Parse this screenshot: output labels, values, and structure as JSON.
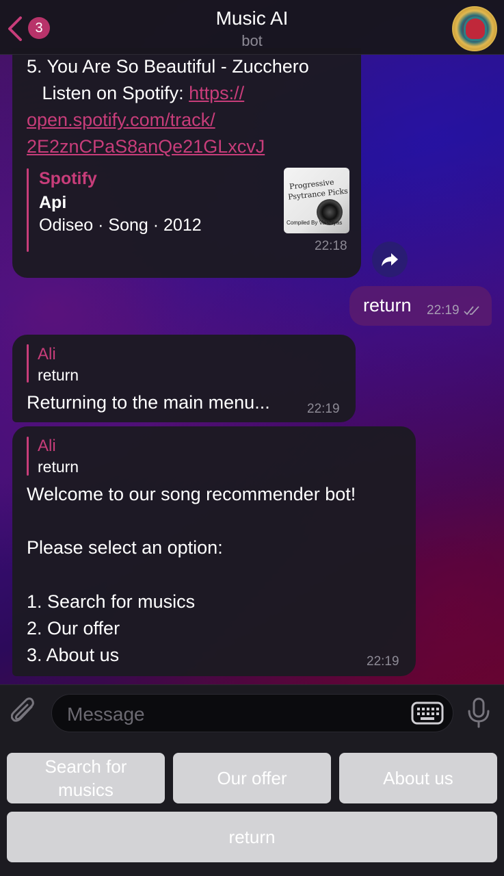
{
  "header": {
    "back_badge": "3",
    "title": "Music AI",
    "subtitle": "bot"
  },
  "messages": {
    "m1": {
      "line1": "5. You Are So Beautiful - Zucchero",
      "line2": "   Listen on Spotify: ",
      "link1": "https://",
      "link2": "open.spotify.com/track/",
      "link3": "2E2znCPaS8anQe21GLxcvJ",
      "preview": {
        "site": "Spotify",
        "title": "Api",
        "desc": "Odiseo · Song · 2012",
        "thumb_line1": "Progressive",
        "thumb_line2": "Psytrance Picks",
        "thumb_line3": "Compiled By Vaishiyas"
      },
      "time": "22:18"
    },
    "m2": {
      "text": "return",
      "time": "22:19"
    },
    "m3": {
      "quote_name": "Ali",
      "quote_text": "return",
      "text": "Returning to the main menu...",
      "time": "22:19"
    },
    "m4": {
      "quote_name": "Ali",
      "quote_text": "return",
      "lines": [
        "Welcome to our song recommender bot!",
        "",
        "Please select an option:",
        "",
        "1. Search for musics",
        "2. Our offer",
        "3. About us"
      ],
      "time": "22:19"
    }
  },
  "input": {
    "placeholder": "Message"
  },
  "keyboard": {
    "b1_line1": "Search for",
    "b1_line2": "musics",
    "b2": "Our offer",
    "b3": "About us",
    "b4": "return"
  },
  "icons": {
    "back": "chevron-left-icon",
    "share": "share-icon",
    "attach": "paperclip-icon",
    "keyboard": "keyboard-icon",
    "mic": "microphone-icon",
    "read": "double-check-icon"
  },
  "colors": {
    "accent": "#c83d7a",
    "badge": "#b8336a",
    "bubble_in": "#1c1a22",
    "bubble_out": "#581a70",
    "keyboard_button": "#d3d3d6"
  }
}
